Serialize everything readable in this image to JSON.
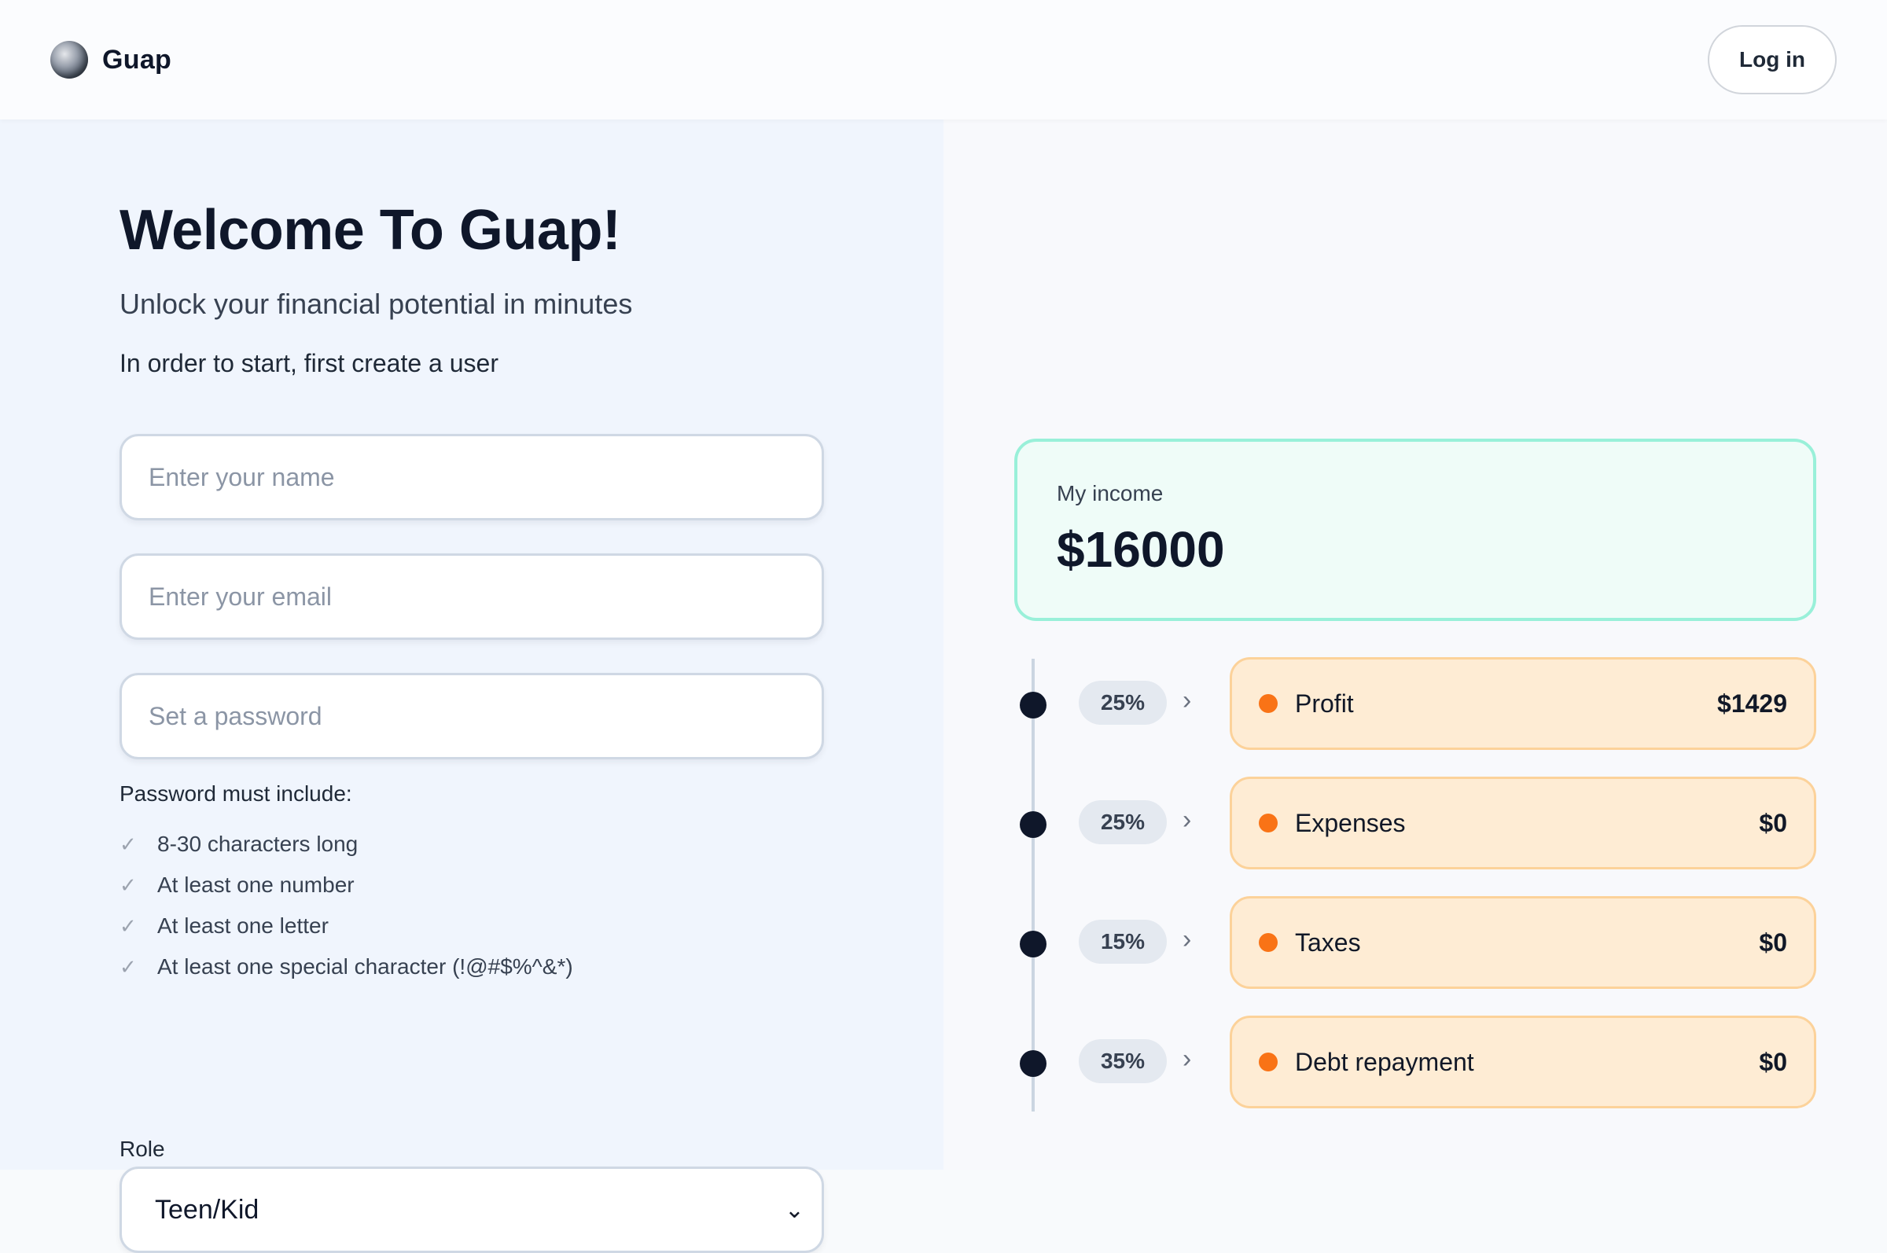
{
  "header": {
    "brand": "Guap",
    "login_label": "Log in"
  },
  "signup": {
    "title": "Welcome To Guap!",
    "subtitle": "Unlock your financial potential in minutes",
    "instruction": "In order to start, first create a user",
    "name_placeholder": "Enter your name",
    "email_placeholder": "Enter your email",
    "password_placeholder": "Set a password",
    "password_heading": "Password must include:",
    "password_requirements": [
      "8-30 characters long",
      "At least one number",
      "At least one letter",
      "At least one special character (!@#$%^&*)"
    ],
    "role_label": "Role",
    "role_value": "Teen/Kid"
  },
  "income": {
    "label": "My income",
    "value": "$16000"
  },
  "allocations": [
    {
      "percent": "25%",
      "name": "Profit",
      "amount": "$1429"
    },
    {
      "percent": "25%",
      "name": "Expenses",
      "amount": "$0"
    },
    {
      "percent": "15%",
      "name": "Taxes",
      "amount": "$0"
    },
    {
      "percent": "35%",
      "name": "Debt repayment",
      "amount": "$0"
    }
  ],
  "colors": {
    "accent_orange": "#f97316",
    "income_border": "#99f0d9",
    "category_bg": "#feecd4"
  }
}
